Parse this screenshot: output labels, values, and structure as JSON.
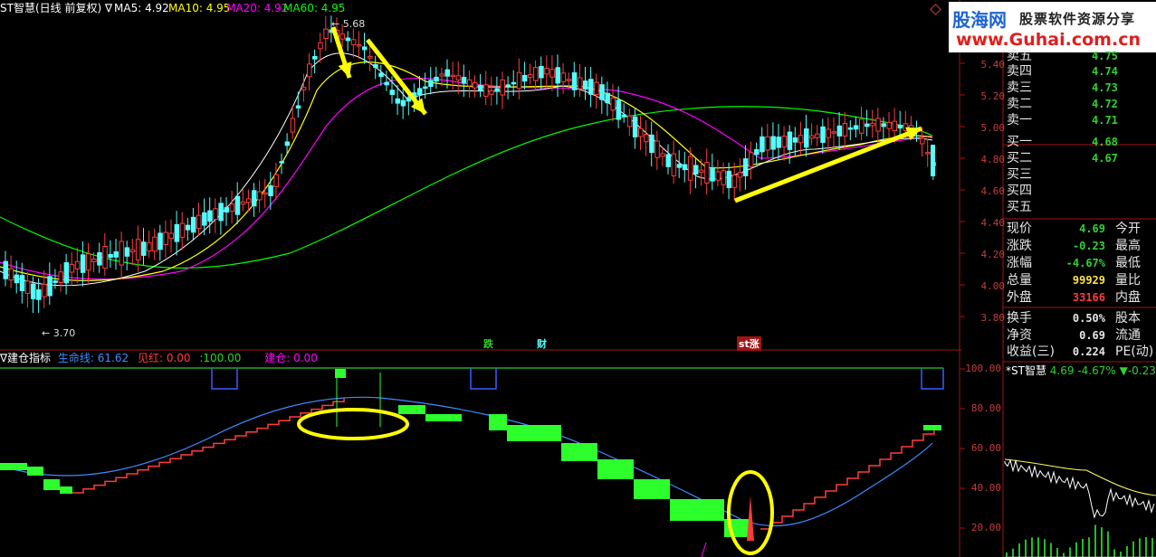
{
  "header": {
    "symbol_title": "ST智慧(日线 前复权)",
    "ma5_label": "MA5:",
    "ma5_value": "4.92",
    "ma10_label": "MA10:",
    "ma10_value": "4.95",
    "ma20_label": "MA20:",
    "ma20_value": "4.92",
    "ma60_label": "MA60:",
    "ma60_value": "4.95"
  },
  "logo": {
    "brand": "股海网",
    "slogan": "股票软件资源分享",
    "url": "www.Guhai.com.cn"
  },
  "price_axis": [
    "5.40",
    "5.20",
    "5.00",
    "4.80",
    "4.60",
    "4.40",
    "4.20",
    "4.00",
    "3.80"
  ],
  "indicator_axis": [
    "100.00",
    "80.00",
    "60.00",
    "40.00",
    "20.00"
  ],
  "annotations": {
    "high_label": "5.68",
    "low_label": "3.70",
    "event_tags": [
      "跌",
      "财",
      "st涨"
    ]
  },
  "indicator_header": {
    "name": "建仓指标",
    "life_line_label": "生命线:",
    "life_line_value": "61.62",
    "see_red_label": "见红:",
    "see_red_value": "0.00",
    "blank_label": ":",
    "blank_value": "100.00",
    "build_label": "建仓:",
    "build_value": "0.00"
  },
  "order_book": {
    "asks": [
      {
        "label": "卖五",
        "price": "4.75"
      },
      {
        "label": "卖四",
        "price": "4.74"
      },
      {
        "label": "卖三",
        "price": "4.73"
      },
      {
        "label": "卖二",
        "price": "4.72"
      },
      {
        "label": "卖一",
        "price": "4.71"
      }
    ],
    "bids": [
      {
        "label": "买一",
        "price": "4.68"
      },
      {
        "label": "买二",
        "price": "4.67"
      },
      {
        "label": "买三",
        "price": ""
      },
      {
        "label": "买四",
        "price": ""
      },
      {
        "label": "买五",
        "price": ""
      }
    ]
  },
  "quote": [
    {
      "label": "现价",
      "value": "4.69",
      "right": "今开",
      "color": "green"
    },
    {
      "label": "涨跌",
      "value": "-0.23",
      "right": "最高",
      "color": "green"
    },
    {
      "label": "涨幅",
      "value": "-4.67%",
      "right": "最低",
      "color": "green"
    },
    {
      "label": "总量",
      "value": "99929",
      "right": "量比",
      "color": "yellow"
    },
    {
      "label": "外盘",
      "value": "33166",
      "right": "内盘",
      "color": "red"
    }
  ],
  "stats": [
    {
      "label": "换手",
      "value": "0.50%",
      "right": "股本"
    },
    {
      "label": "净资",
      "value": "0.69",
      "right": "流通"
    },
    {
      "label": "收益(三)",
      "value": "0.224",
      "right": "PE(动)"
    }
  ],
  "mini": {
    "name": "*ST智慧",
    "price": "4.69",
    "pct": "-4.67%",
    "change": "▼-0.23"
  },
  "colors": {
    "up_red": "#ff3c3c",
    "down_cyan": "#54ffff",
    "ma5": "#ffffff",
    "ma10": "#ffff00",
    "ma20": "#ff00ff",
    "ma60": "#00ff00",
    "grid_red": "#a01414",
    "life_line": "#3c8cff",
    "highlight": "#ffff00"
  }
}
